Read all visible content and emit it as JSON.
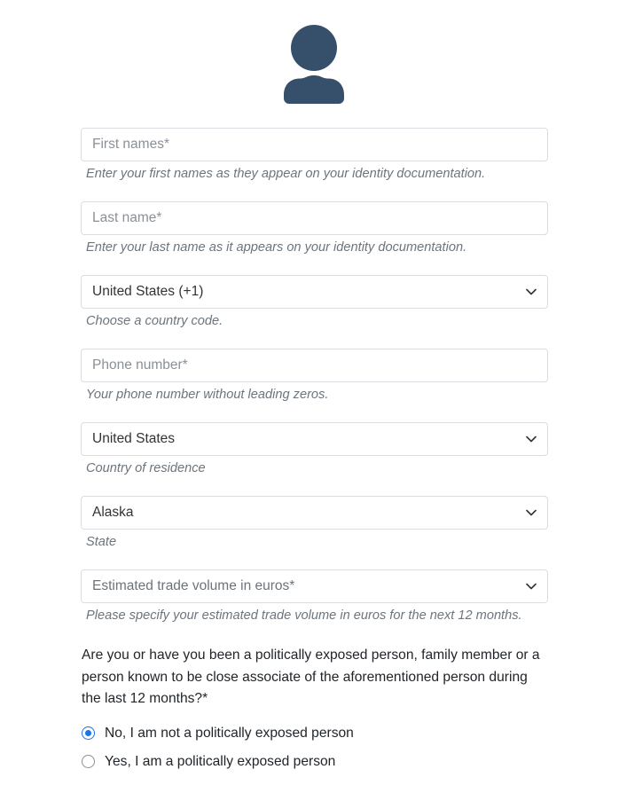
{
  "avatar": {
    "icon": "person-icon",
    "color": "#36506b"
  },
  "form": {
    "fields": [
      {
        "name": "first-names",
        "type": "text",
        "placeholder": "First names*",
        "value": "",
        "helper": "Enter your first names as they appear on your identity documentation."
      },
      {
        "name": "last-name",
        "type": "text",
        "placeholder": "Last name*",
        "value": "",
        "helper": "Enter your last name as it appears on your identity documentation."
      },
      {
        "name": "country-code",
        "type": "select",
        "value": "United States (+1)",
        "is_placeholder": false,
        "helper": "Choose a country code."
      },
      {
        "name": "phone-number",
        "type": "text",
        "placeholder": "Phone number*",
        "value": "",
        "helper": "Your phone number without leading zeros."
      },
      {
        "name": "country-of-residence",
        "type": "select",
        "value": "United States",
        "is_placeholder": false,
        "helper": "Country of residence"
      },
      {
        "name": "state",
        "type": "select",
        "value": "Alaska",
        "is_placeholder": false,
        "helper": "State"
      },
      {
        "name": "trade-volume",
        "type": "select",
        "value": "Estimated trade volume in euros*",
        "is_placeholder": true,
        "helper": "Please specify your estimated trade volume in euros for the next 12 months."
      }
    ]
  },
  "pep": {
    "question": "Are you or have you been a politically exposed person, family member or a person known to be close associate of the aforementioned person during the last 12 months?*",
    "options": [
      {
        "label": "No, I am not a politically exposed person",
        "checked": true
      },
      {
        "label": "Yes, I am a politically exposed person",
        "checked": false
      }
    ],
    "accent_color": "#1a73e8"
  },
  "icons": {
    "chevron_down": "chevron-down-icon"
  }
}
